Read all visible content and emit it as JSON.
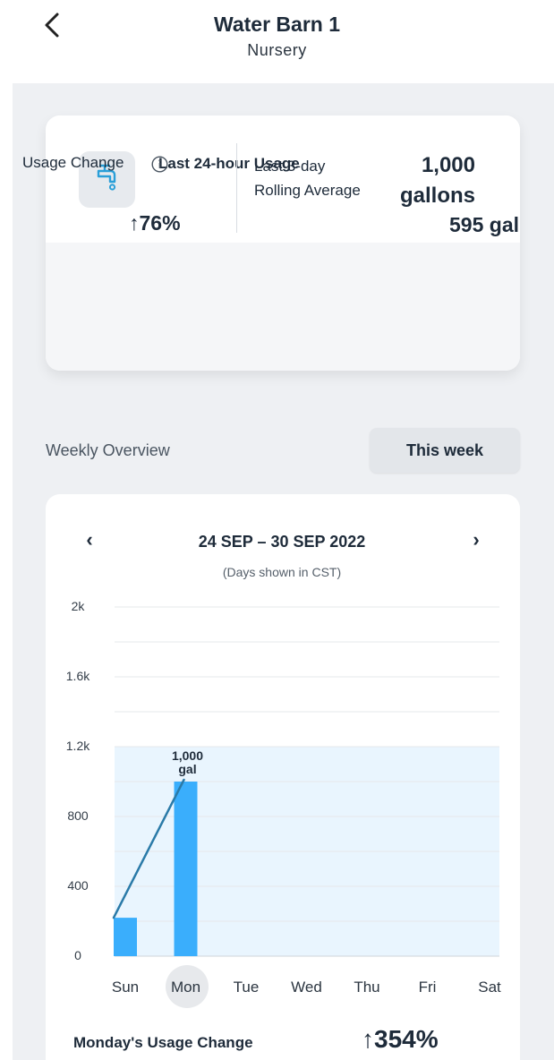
{
  "header": {
    "title": "Water Barn 1",
    "subtitle": "Nursery"
  },
  "usage_card": {
    "label": "Last 24-hour Usage",
    "value_line1": "1,000",
    "value_line2": "gallons",
    "change_label": "Usage Change",
    "change_value": "76%",
    "avg_label_line1": "Last 3-day",
    "avg_label_line2": "Rolling Average",
    "avg_value": "595 gal"
  },
  "weekly": {
    "label": "Weekly Overview",
    "button": "This week",
    "date_range": "24 SEP – 30 SEP 2022",
    "tz_note": "(Days shown in CST)",
    "selected_day": "Mon"
  },
  "chart_data": {
    "type": "bar",
    "categories": [
      "Sun",
      "Mon",
      "Tue",
      "Wed",
      "Thu",
      "Fri",
      "Sat"
    ],
    "values": [
      220,
      1000,
      null,
      null,
      null,
      null,
      null
    ],
    "y_ticks": [
      "0",
      "400",
      "800",
      "1.2k",
      "1.6k",
      "2k"
    ],
    "ylim": [
      0,
      2000
    ],
    "highlight_band": [
      0,
      1200
    ],
    "annotation": {
      "category": "Mon",
      "text_line1": "1,000",
      "text_line2": "gal"
    },
    "colors": {
      "bar": "#3aaefc",
      "band": "#e9f5fe",
      "trend": "#2a7aa8"
    }
  },
  "footer": {
    "label": "Monday's Usage Change",
    "value": "354%"
  },
  "icons": {
    "back": "chevron-left-icon",
    "tap": "water-tap-icon",
    "info": "info-icon"
  }
}
